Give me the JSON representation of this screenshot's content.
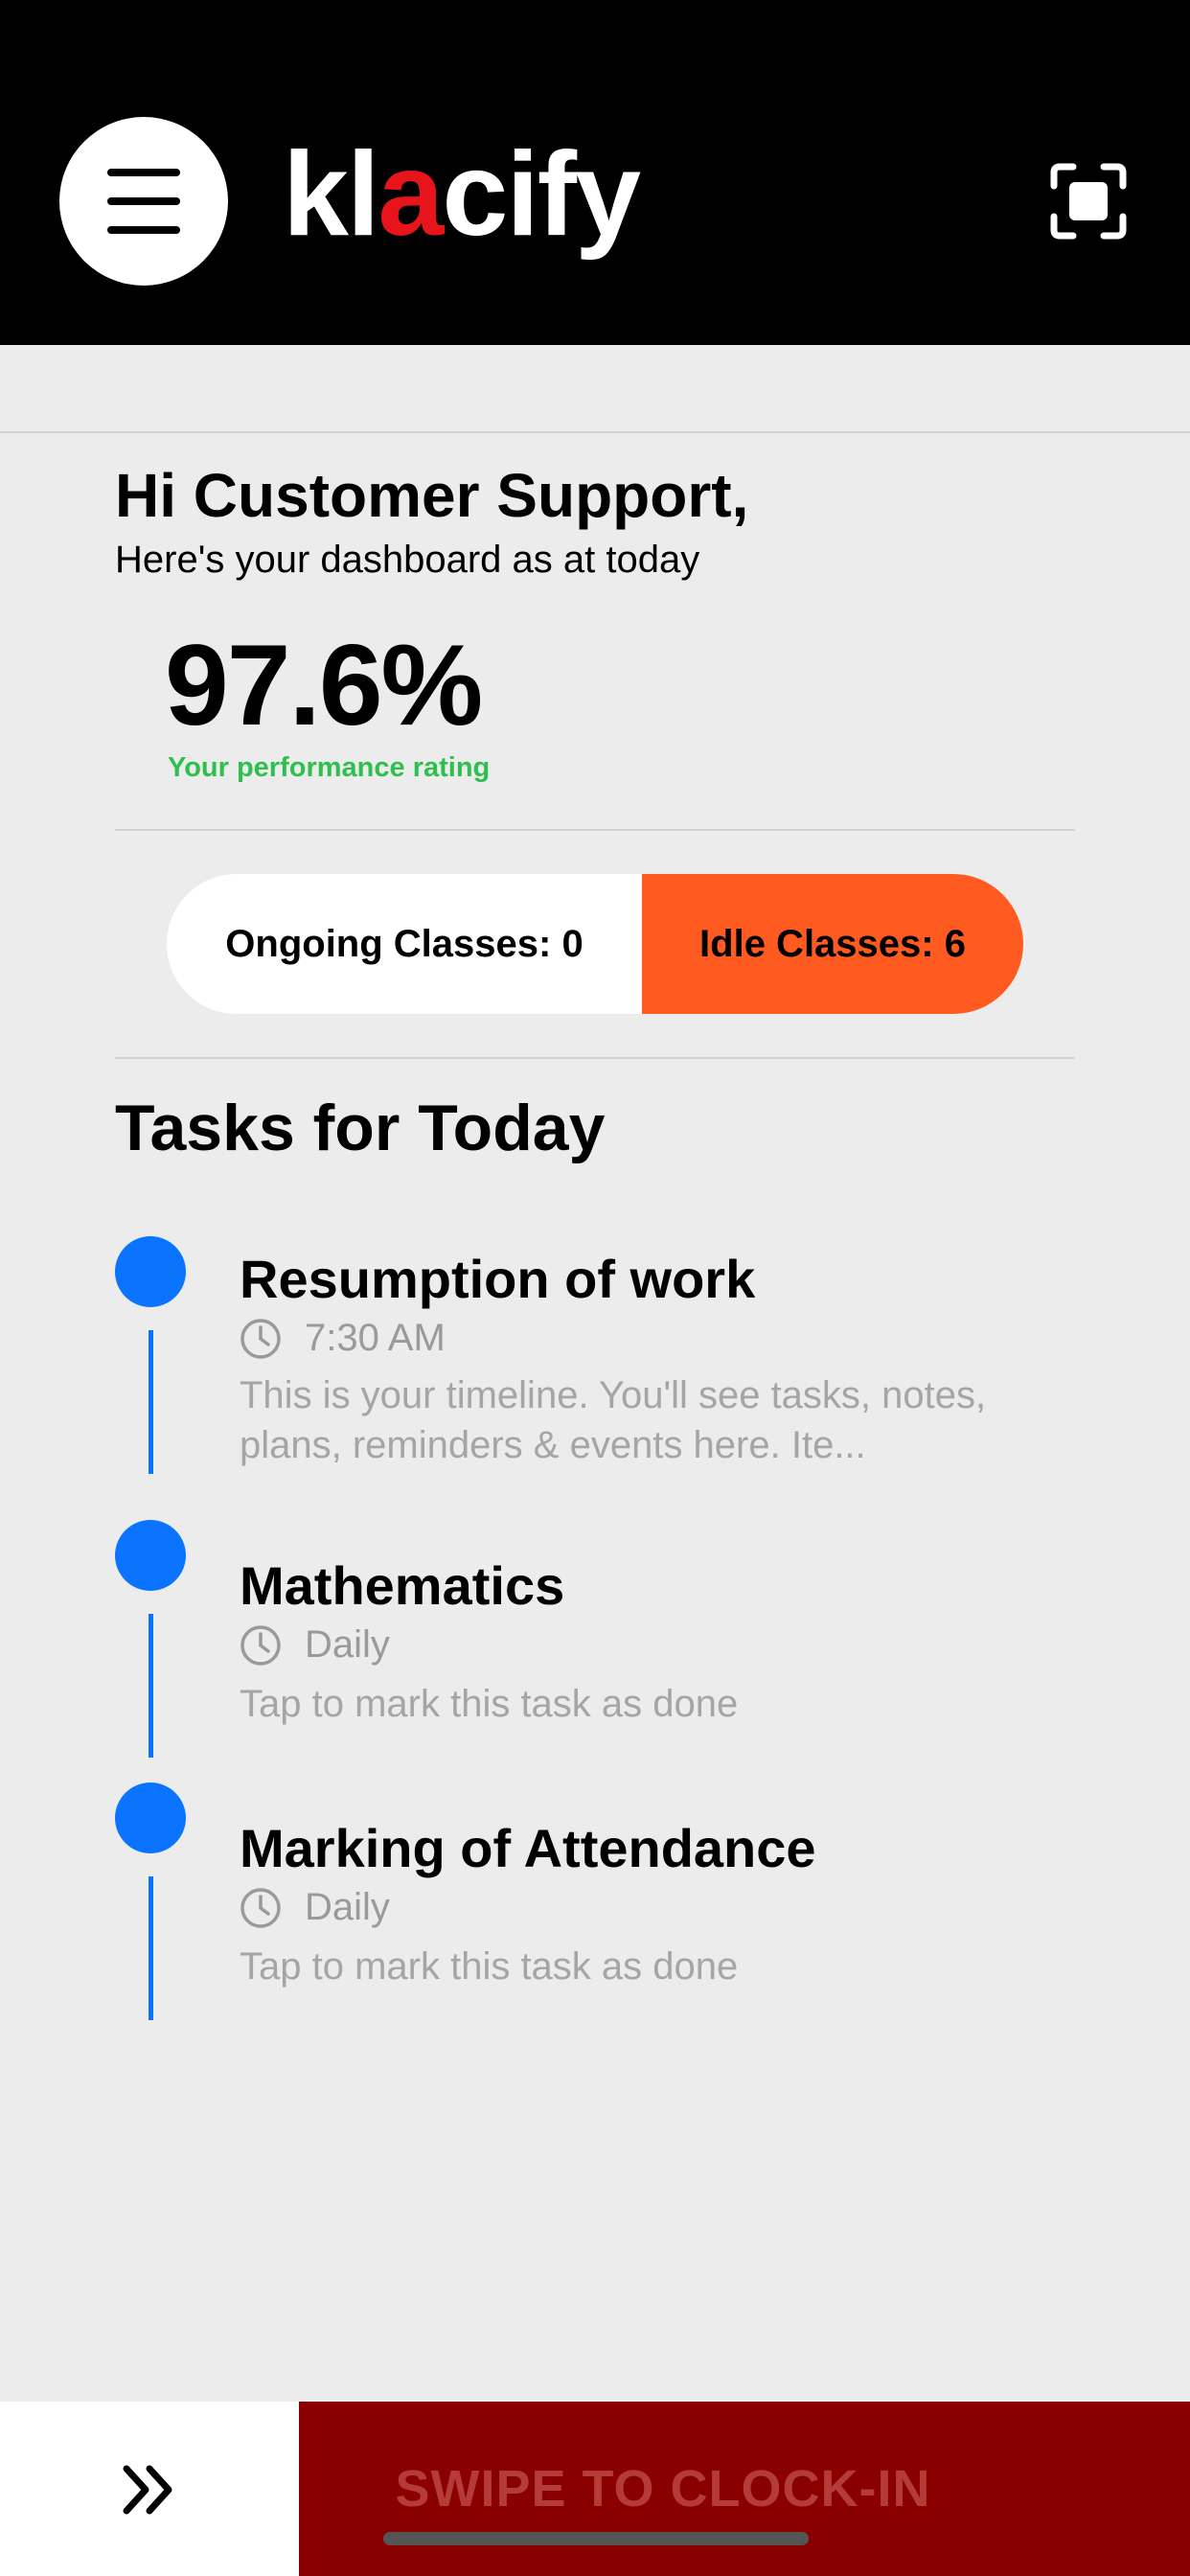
{
  "header": {
    "logo_prefix": "kl",
    "logo_accent": "a",
    "logo_suffix": "cify",
    "menu_icon": "hamburger-icon",
    "scan_icon": "scan-frame-icon"
  },
  "greeting": {
    "title": "Hi Customer Support,",
    "subtitle": "Here's your dashboard as at today"
  },
  "performance": {
    "value": "97.6%",
    "label": "Your performance rating"
  },
  "classes": {
    "ongoing_label": "Ongoing Classes: 0",
    "idle_label": "Idle Classes: 6"
  },
  "tasks": {
    "heading": "Tasks for Today",
    "items": [
      {
        "title": "Resumption of work",
        "time": "7:30 AM",
        "description": "This is your timeline. You'll see tasks, notes, plans, reminders & events here. Ite..."
      },
      {
        "title": "Mathematics",
        "time": "Daily",
        "description": "Tap to mark this task as done"
      },
      {
        "title": "Marking of Attendance",
        "time": "Daily",
        "description": "Tap to mark this task as done"
      }
    ]
  },
  "clock_in": {
    "label": "SWIPE TO CLOCK-IN",
    "handle_icon": "double-chevron-right-icon"
  },
  "colors": {
    "header_bg": "#000000",
    "logo_accent": "#e8141c",
    "rating_label": "#2fbf4f",
    "idle_pill": "#ff5a1f",
    "timeline": "#0a74ff",
    "swipe_bar": "#8a0000"
  }
}
